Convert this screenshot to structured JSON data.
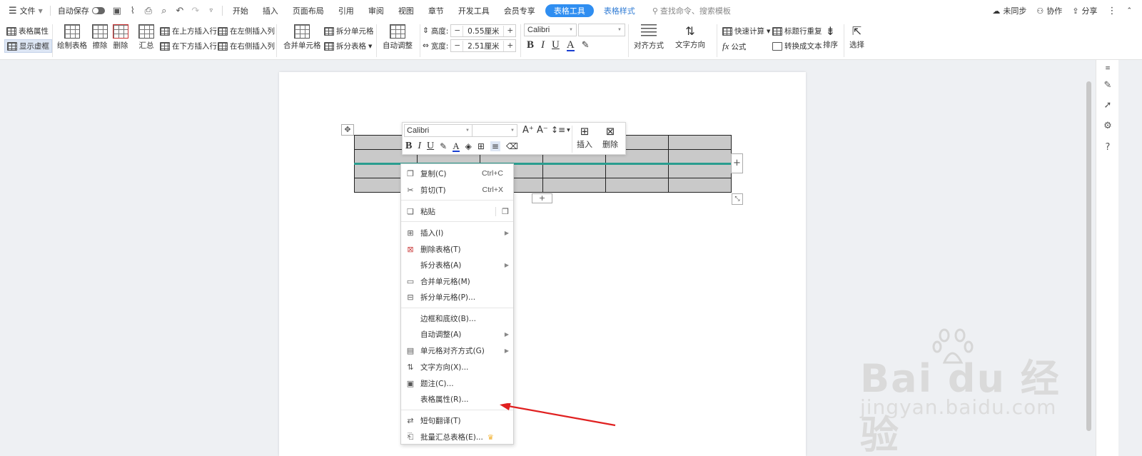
{
  "topbar": {
    "menu_label": "文件",
    "autosave_label": "自动保存",
    "tabs": [
      "开始",
      "插入",
      "页面布局",
      "引用",
      "审阅",
      "视图",
      "章节",
      "开发工具",
      "会员专享"
    ],
    "active_tab": "表格工具",
    "extra_tab": "表格样式",
    "search_placeholder": "查找命令、搜索模板",
    "unsync": "未同步",
    "collab": "协作",
    "share": "分享"
  },
  "ribbon": {
    "table_props": "表格属性",
    "show_gridlines": "显示虚框",
    "draw_table": "绘制表格",
    "erase": "擦除",
    "delete": "删除",
    "summary": "汇总",
    "insert_above": "在上方插入行",
    "insert_below": "在下方插入行",
    "insert_left": "在左侧插入列",
    "insert_right": "在右侧插入列",
    "merge_cells": "合并单元格",
    "split_cells": "拆分单元格",
    "split_table": "拆分表格",
    "auto_adjust": "自动调整",
    "height_label": "高度:",
    "height_value": "0.55厘米",
    "width_label": "宽度:",
    "width_value": "2.51厘米",
    "font_name": "Calibri",
    "align": "对齐方式",
    "text_dir": "文字方向",
    "quick_calc": "快速计算",
    "formula": "公式",
    "repeat_header": "标题行重复",
    "to_text": "转换成文本",
    "sort": "排序",
    "select": "选择"
  },
  "mini_toolbar": {
    "font_name": "Calibri",
    "insert": "插入",
    "delete": "删除"
  },
  "context_menu": [
    {
      "label": "复制(C)",
      "shortcut": "Ctrl+C",
      "icon": "copy-icon"
    },
    {
      "label": "剪切(T)",
      "shortcut": "Ctrl+X",
      "icon": "cut-icon"
    },
    {
      "label": "粘贴",
      "icon": "paste-icon"
    },
    {
      "label": "插入(I)",
      "icon": "table-insert-icon",
      "submenu": true
    },
    {
      "label": "删除表格(T)",
      "icon": "table-delete-icon"
    },
    {
      "label": "拆分表格(A)",
      "submenu": true
    },
    {
      "label": "合并单元格(M)",
      "icon": "merge-cells-icon"
    },
    {
      "label": "拆分单元格(P)...",
      "icon": "split-cells-icon"
    },
    {
      "label": "边框和底纹(B)..."
    },
    {
      "label": "自动调整(A)",
      "submenu": true
    },
    {
      "label": "单元格对齐方式(G)",
      "icon": "cell-align-icon",
      "submenu": true
    },
    {
      "label": "文字方向(X)...",
      "icon": "text-direction-icon"
    },
    {
      "label": "题注(C)...",
      "icon": "caption-icon"
    },
    {
      "label": "表格属性(R)..."
    },
    {
      "label": "短句翻译(T)",
      "icon": "translate-icon"
    },
    {
      "label": "批量汇总表格(E)...",
      "icon": "batch-summary-icon"
    }
  ],
  "watermark": {
    "main": "Bai du 经验",
    "sub": "jingyan.baidu.com"
  },
  "colors": {
    "accent": "#2f8ef1",
    "teal": "#2a9d8f",
    "arrow": "#e02020"
  }
}
